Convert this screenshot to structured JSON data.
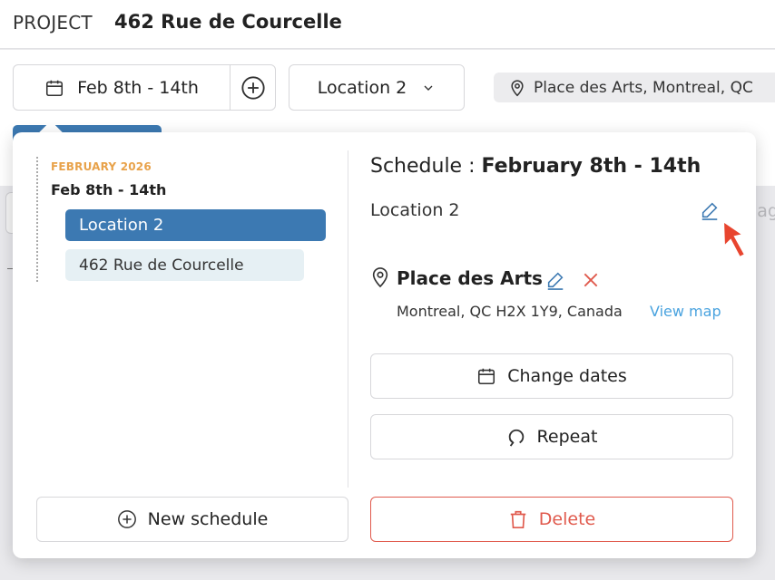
{
  "header": {
    "project_label": "PROJECT",
    "project_name": "462 Rue de Courcelle"
  },
  "filters": {
    "date_range": "Feb 8th - 14th",
    "location": "Location 2",
    "place": "Place des Arts, Montreal, QC"
  },
  "background": {
    "ghost_text": "Hag"
  },
  "popover": {
    "sidebar": {
      "month": "FEBRUARY 2026",
      "range": "Feb 8th - 14th",
      "items": [
        {
          "label": "Location 2",
          "active": true
        },
        {
          "label": "462 Rue de Courcelle",
          "active": false
        }
      ],
      "new_schedule_label": "New schedule"
    },
    "detail": {
      "title_prefix": "Schedule : ",
      "title_range": "February 8th - 14th",
      "location": "Location 2",
      "place_name": "Place des Arts",
      "place_address": "Montreal, QC H2X 1Y9, Canada",
      "view_map_label": "View map",
      "change_dates_label": "Change dates",
      "repeat_label": "Repeat",
      "delete_label": "Delete"
    }
  },
  "colors": {
    "accent": "#3c79b2",
    "month": "#e8a24a",
    "link": "#4aa3df",
    "danger": "#e05a4d"
  },
  "icons": [
    "calendar-icon",
    "plus-circle-icon",
    "chevron-down-icon",
    "map-pin-icon",
    "pencil-icon",
    "close-icon",
    "repeat-icon",
    "trash-icon",
    "cursor-arrow-icon"
  ]
}
